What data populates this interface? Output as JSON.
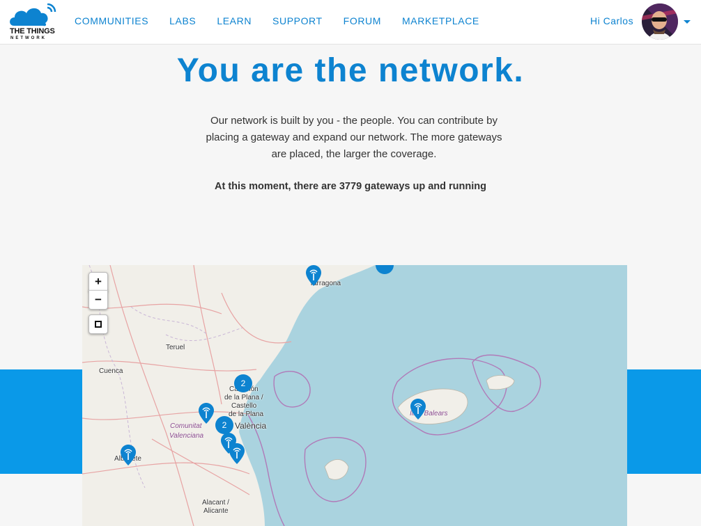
{
  "brand": {
    "name_line1": "THE THINGS",
    "name_line2": "NETWORK",
    "color": "#0d83d0"
  },
  "nav": {
    "items": [
      "COMMUNITIES",
      "LABS",
      "LEARN",
      "SUPPORT",
      "FORUM",
      "MARKETPLACE"
    ]
  },
  "user": {
    "greeting": "Hi Carlos"
  },
  "hero": {
    "title": "You are the network.",
    "intro": "Our network is built by you - the people. You can contribute by placing a gateway and expand our network. The more gateways are placed, the larger the coverage.",
    "stat": "At this moment, there are 3779 gateways up and running"
  },
  "map": {
    "controls": {
      "zoom_in": "+",
      "zoom_out": "−"
    },
    "cities": {
      "tarragona": "Tarragona",
      "teruel": "Teruel",
      "cuenca": "Cuenca",
      "castellon_1": "Castellón",
      "castellon_2": "de la Plana /",
      "castellon_3": "Castello",
      "castellon_4": "de la Plana",
      "valencia": "València",
      "albacete": "Albacete",
      "alicante_1": "Alacant /",
      "alicante_2": "Alicante"
    },
    "regions": {
      "comunitat_1": "Comunitat",
      "comunitat_2": "Valenciana",
      "baleares": "Illes Balears"
    },
    "clusters": {
      "castellon": "2",
      "valencia": "2"
    }
  }
}
